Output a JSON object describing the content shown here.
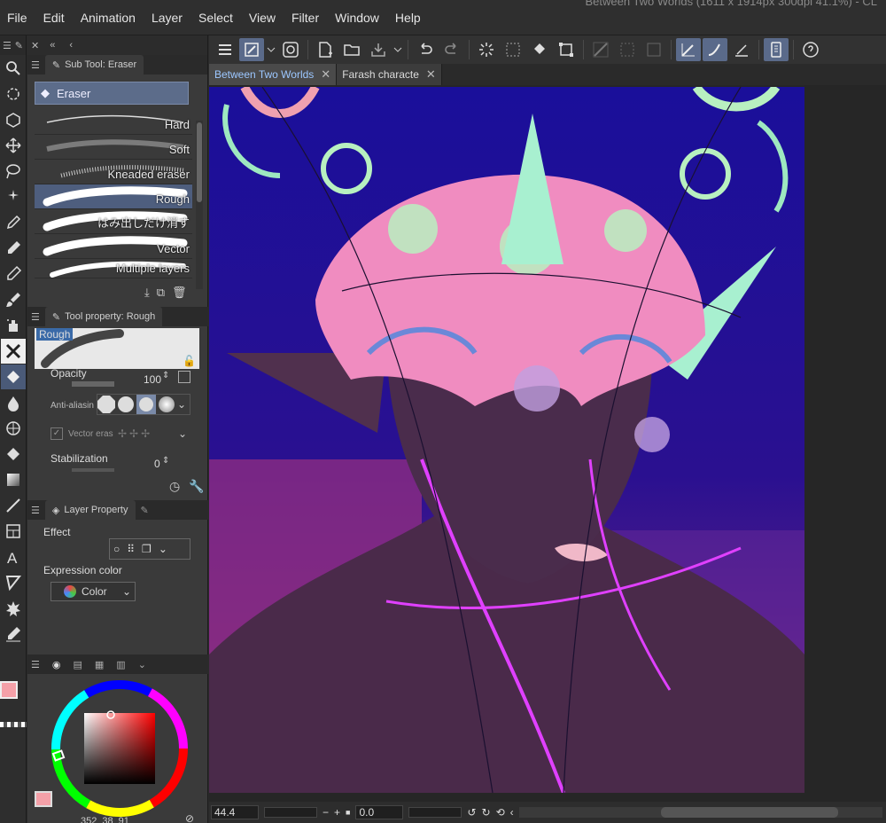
{
  "window": {
    "title": "Between Two Worlds (1611 x 1914px 300dpi 41.1%) - CL"
  },
  "menu": [
    "File",
    "Edit",
    "Animation",
    "Layer",
    "Select",
    "View",
    "Filter",
    "Window",
    "Help"
  ],
  "subtool_panel": {
    "title": "Sub Tool: Eraser",
    "group": "Eraser",
    "brushes": [
      {
        "label": "Hard"
      },
      {
        "label": "Soft"
      },
      {
        "label": "Kneaded eraser"
      },
      {
        "label": "Rough",
        "selected": true
      },
      {
        "label": "はみ出しだけ消す"
      },
      {
        "label": "Vector"
      },
      {
        "label": "Multiple layers"
      }
    ]
  },
  "tool_property": {
    "title": "Tool property: Rough",
    "preset_name": "Rough",
    "opacity_label": "Opacity",
    "opacity_value": "100",
    "anti_aliasing_label": "Anti-aliasin",
    "vector_erase_label": "Vector eras",
    "stabilization_label": "Stabilization",
    "stabilization_value": "0"
  },
  "layer_property": {
    "title": "Layer Property",
    "effect_label": "Effect",
    "expression_color_label": "Expression color",
    "expression_color_value": "Color"
  },
  "color": {
    "main": "#f4a0a8",
    "sub": "#2a0a0a",
    "values": {
      "h": "352",
      "s": "38",
      "v": "91"
    }
  },
  "tabs": [
    {
      "label": "Between Two Worlds",
      "active": true
    },
    {
      "label": "Farash characte",
      "active": false
    }
  ],
  "status": {
    "zoom": "44.4",
    "angle": "0.0"
  },
  "icons": {
    "tools": [
      "magnifier-icon",
      "rotate-icon",
      "object-icon",
      "move-icon",
      "lasso-icon",
      "magic-wand-icon",
      "eyedropper-icon",
      "pen-icon",
      "pencil-icon",
      "brush-icon",
      "airbrush-icon",
      "eraser-icon",
      "eraser-active-icon",
      "blend-icon",
      "mesh-icon",
      "fill-icon",
      "gradient-icon",
      "line-icon",
      "frame-icon",
      "text-icon",
      "balloon-icon",
      "burst-icon",
      "ruler-icon"
    ]
  }
}
